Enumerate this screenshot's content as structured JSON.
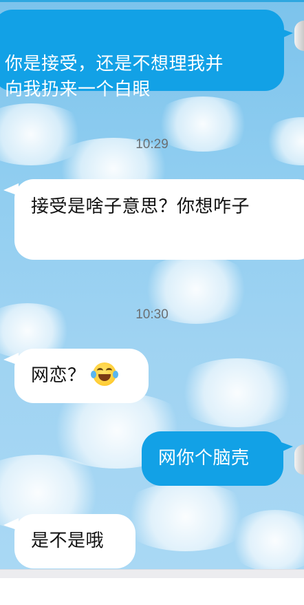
{
  "messages": [
    {
      "side": "out",
      "text": "你是接受，还是不想理我并\n向我扔来一个白眼"
    },
    {
      "side": "in",
      "text": "接受是啥子意思？你想咋子"
    },
    {
      "side": "in",
      "text": "网恋？",
      "emoji": "face-with-tears-of-joy"
    },
    {
      "side": "out",
      "text": "网你个脑壳"
    },
    {
      "side": "in",
      "text": "是不是哦"
    }
  ],
  "timestamps": [
    "10:29",
    "10:30"
  ],
  "colors": {
    "outgoing_bubble": "#12a1e6",
    "incoming_bubble": "#ffffff",
    "background": "#8fcdf0",
    "timestamp": "#6b6f72"
  }
}
